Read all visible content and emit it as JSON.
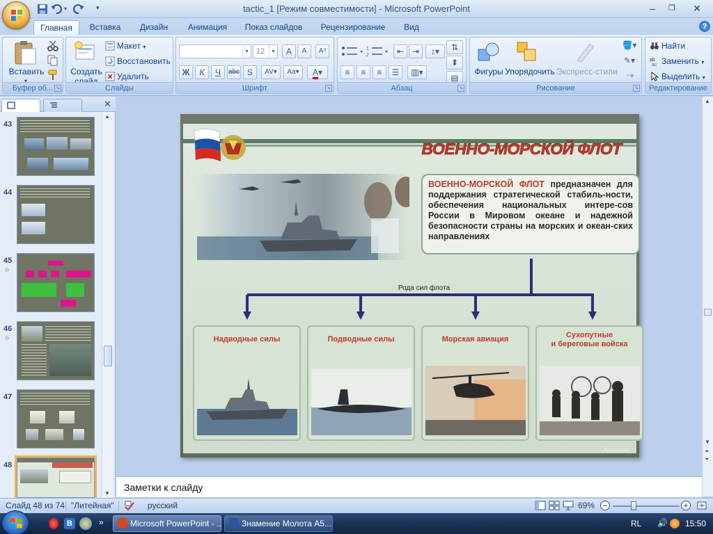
{
  "window": {
    "title": "tactic_1 [Режим совместимости] - Microsoft PowerPoint"
  },
  "tabs": [
    "Главная",
    "Вставка",
    "Дизайн",
    "Анимация",
    "Показ слайдов",
    "Рецензирование",
    "Вид"
  ],
  "ribbon": {
    "clipboard": {
      "label": "Буфер об...",
      "paste": "Вставить"
    },
    "slides": {
      "label": "Слайды",
      "new_slide_1": "Создать",
      "new_slide_2": "слайд",
      "layout": "Макет",
      "reset": "Восстановить",
      "delete": "Удалить"
    },
    "font": {
      "label": "Шрифт",
      "font_name": "",
      "font_size": "12"
    },
    "paragraph": {
      "label": "Абзац"
    },
    "drawing": {
      "label": "Рисование",
      "shapes": "Фигуры",
      "arrange": "Упорядочить",
      "styles": "Экспресс-стили"
    },
    "editing": {
      "label": "Редактирование",
      "find": "Найти",
      "replace": "Заменить",
      "select": "Выделить"
    }
  },
  "panel": {
    "thumbs": [
      {
        "num": "43"
      },
      {
        "num": "44"
      },
      {
        "num": "45"
      },
      {
        "num": "46"
      },
      {
        "num": "47"
      },
      {
        "num": "48"
      }
    ]
  },
  "slide": {
    "header": "ВОЕННО-МОРСКОЙ ФЛОТ",
    "desc_bold": "ВОЕННО-МОРСКОЙ ФЛОТ",
    "desc_rest": " предназначен для поддержания стратегической стабиль-ности, обеспечения национальных интере-сов России в Мировом океане и надежной безопасности страны на морских и океан-ских направлениях",
    "branches_label": "Рода сил флота",
    "cards": [
      {
        "title": "Надводные силы"
      },
      {
        "title": "Подводные силы"
      },
      {
        "title": "Морская авиация"
      },
      {
        "title": "Сухопутные\nи береговые войска"
      }
    ],
    "credit": "Армпресс"
  },
  "notes": {
    "placeholder": "Заметки к слайду"
  },
  "status": {
    "slide_counter": "Слайд 48 из 74",
    "theme": "\"Литейная\"",
    "language": "русский",
    "zoom": "69%"
  },
  "taskbar": {
    "items": [
      "Microsoft PowerPoint - ...",
      "Знамение Молота А5..."
    ],
    "lang": "RL",
    "time": "15:50"
  },
  "colors": {
    "accent": "#15428b",
    "ribbon": "#d5e4f6",
    "slide_header": "#c0392b",
    "arrow": "#2e2c78"
  }
}
